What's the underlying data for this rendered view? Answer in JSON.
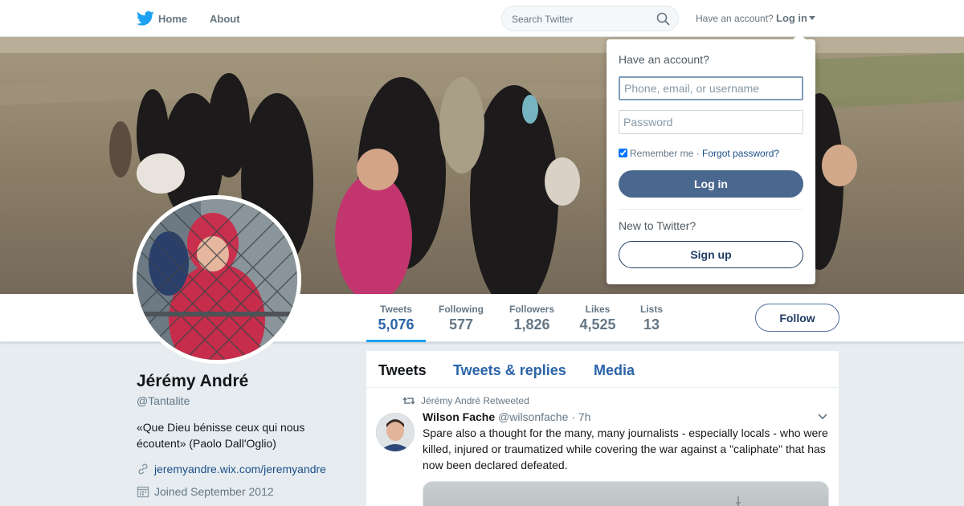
{
  "nav": {
    "home_label": "Home",
    "about_label": "About",
    "search_placeholder": "Search Twitter",
    "have_account": "Have an account?",
    "login_label": "Log in",
    "brand_color": "#1da1f2"
  },
  "profile": {
    "name": "Jérémy André",
    "handle": "@Tantalite",
    "bio": "«Que Dieu bénisse ceux qui nous écoutent» (Paolo Dall'Oglio)",
    "website": "jeremyandre.wix.com/jeremyandre",
    "joined": "Joined September 2012",
    "follow_label": "Follow"
  },
  "stats": [
    {
      "label": "Tweets",
      "value": "5,076",
      "active": true
    },
    {
      "label": "Following",
      "value": "577"
    },
    {
      "label": "Followers",
      "value": "1,826"
    },
    {
      "label": "Likes",
      "value": "4,525"
    },
    {
      "label": "Lists",
      "value": "13"
    }
  ],
  "timeline": {
    "tabs": [
      {
        "label": "Tweets",
        "active": true
      },
      {
        "label": "Tweets & replies"
      },
      {
        "label": "Media"
      }
    ],
    "tweet": {
      "retweeted_by": "Jérémy André Retweeted",
      "author_name": "Wilson Fache",
      "author_handle": "@wilsonfache",
      "time": "· 7h",
      "text": "Spare also a thought for the many, many journalists - especially locals - who were killed, injured or traumatized while covering the war against a \"caliphate\" that has now been declared defeated."
    }
  },
  "login_dropdown": {
    "title": "Have an account?",
    "username_placeholder": "Phone, email, or username",
    "password_placeholder": "Password",
    "remember_label": "Remember me",
    "separator": " · ",
    "forgot_label": "Forgot password?",
    "login_button": "Log in",
    "new_label": "New to Twitter?",
    "signup_button": "Sign up"
  }
}
